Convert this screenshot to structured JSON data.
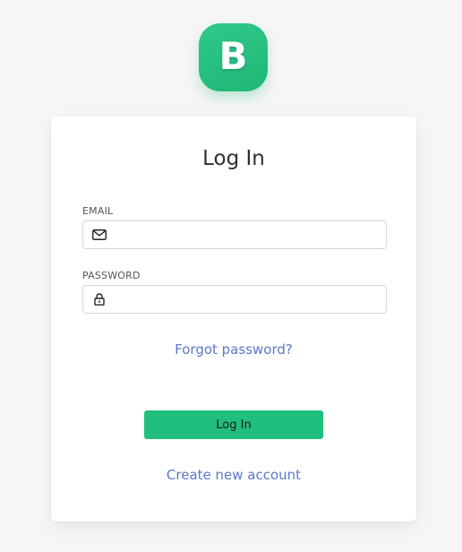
{
  "logo": {
    "letter": "B"
  },
  "colors": {
    "brand": "#20bf7e",
    "link": "#5b78c9",
    "background": "#f6f6f6"
  },
  "login": {
    "title": "Log In",
    "email": {
      "label": "EMAIL",
      "icon": "envelope-icon",
      "value": "",
      "placeholder": ""
    },
    "password": {
      "label": "PASSWORD",
      "icon": "lock-icon",
      "value": "",
      "placeholder": ""
    },
    "forgot_link": "Forgot password?",
    "submit_label": "Log In",
    "create_account_link": "Create new account"
  }
}
